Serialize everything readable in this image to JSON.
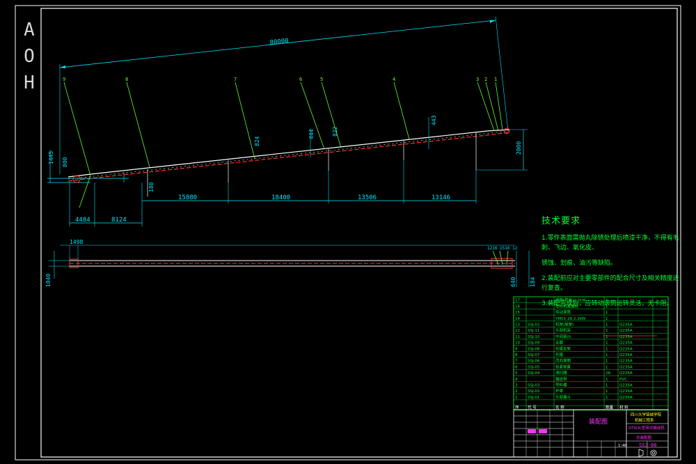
{
  "side_letters": [
    "A",
    "O",
    "H"
  ],
  "dims": {
    "overall_length": "80000",
    "seg1": "15880",
    "seg2": "18400",
    "seg3": "13506",
    "seg4": "13146",
    "left_a": "4484",
    "left_b": "8124",
    "v1445": "1445",
    "v800": "800",
    "v180": "180",
    "v824": "824",
    "v444": "444",
    "v822": "822",
    "v443": "443",
    "height_right": "2000",
    "plan_top": "1498",
    "plan_left": "1040",
    "plan_r1": "640",
    "plan_r2": "184",
    "plan_small": "1216 1516 12"
  },
  "balloons": [
    "9",
    "8",
    "7",
    "6",
    "5",
    "4",
    "3",
    "2",
    "1"
  ],
  "tech_requirements": {
    "title": "技术要求",
    "items": [
      "1.零件表面需抛丸除锈处理后喷漆干净，不得有毛刺、飞边、氧化皮、",
      "锈蚀、划痕、油污等缺陷。",
      "2.装配前应对主要零部件的配合尺寸及相关精度进行复查。",
      "3.装配完成后，应转动滚筒运转灵活，无卡阻。"
    ]
  },
  "bom": {
    "rows": [
      {
        "no": "17",
        "code": "",
        "name": "滚筒(带座)2.2kW",
        "qty": "1",
        "mat": ""
      },
      {
        "no": "16",
        "code": "",
        "name": "电动机减速机",
        "qty": "1",
        "mat": ""
      },
      {
        "no": "15",
        "code": "",
        "name": "传动滚筒",
        "qty": "1",
        "mat": ""
      },
      {
        "no": "14",
        "code": "",
        "name": "YM01-28 2.2kW",
        "qty": "1",
        "mat": ""
      },
      {
        "no": "13",
        "code": "SSJ-02",
        "name": "机架(尾架)",
        "qty": "1",
        "mat": "Q235A"
      },
      {
        "no": "12",
        "code": "SSJ-11",
        "name": "头部机架",
        "qty": "1",
        "mat": "Q235A"
      },
      {
        "no": "11",
        "code": "SSJ-10",
        "name": "中间架(I)",
        "qty": "1",
        "mat": "Q235A"
      },
      {
        "no": "10",
        "code": "SSJ-09",
        "name": "支腿",
        "qty": "1",
        "mat": "Q235A"
      },
      {
        "no": "9",
        "code": "SSJ-08",
        "name": "托辊支架",
        "qty": "1",
        "mat": "Q235A"
      },
      {
        "no": "8",
        "code": "SSJ-07",
        "name": "托辊",
        "qty": "1",
        "mat": "Q235A"
      },
      {
        "no": "7",
        "code": "SSJ-06",
        "name": "改向滚筒",
        "qty": "1",
        "mat": "Q235A"
      },
      {
        "no": "6",
        "code": "SSJ-05",
        "name": "张紧装置",
        "qty": "1",
        "mat": "Q235A"
      },
      {
        "no": "5",
        "code": "SSJ-04",
        "name": "清扫器",
        "qty": "28",
        "mat": "Q235A"
      },
      {
        "no": "4",
        "code": "",
        "name": "输送带",
        "qty": "1",
        "mat": "PVC"
      },
      {
        "no": "3",
        "code": "SSJ-03",
        "name": "导料槽",
        "qty": "1",
        "mat": "Q235A"
      },
      {
        "no": "2",
        "code": "SSJ-02",
        "name": "护罩",
        "qty": "1",
        "mat": "Q235A"
      },
      {
        "no": "1",
        "code": "SSJ-01",
        "name": "头部漏斗",
        "qty": "1",
        "mat": "Q235A"
      }
    ],
    "header": {
      "no": "序",
      "code": "代 号",
      "name": "名 称",
      "qty": "数量",
      "mat": "材 料"
    }
  },
  "title_block": {
    "drawing_name": "装配图",
    "school_line1": "四川大学锦城学院",
    "school_line2": "机械工程系",
    "product_line1": "DTII(A)型带式输送机",
    "product_line2": "总装配图",
    "drawing_no": "SSJ-00",
    "scale": "1:40"
  },
  "colors": {
    "border": "#ffffff",
    "dim": "#00e5ff",
    "leader": "#66ff33",
    "belt_red": "#ff3333",
    "table": "#00ff33",
    "magenta": "#ff33ff",
    "yellow": "#ffff00"
  }
}
